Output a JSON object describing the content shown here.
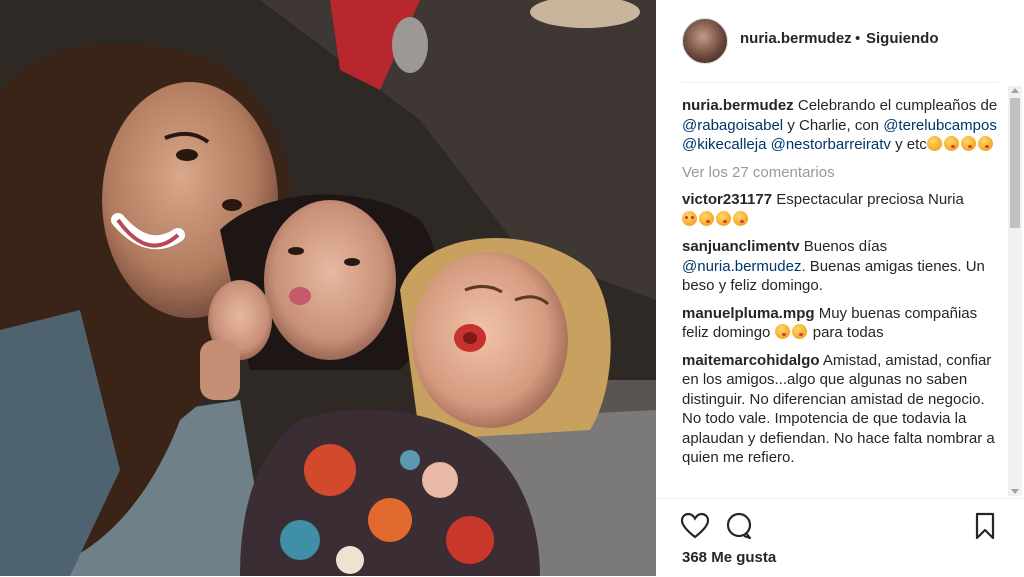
{
  "post": {
    "author": "nuria.bermudez",
    "separator": "•",
    "follow_state": "Siguiendo",
    "likes_text": "368 Me gusta"
  },
  "caption": {
    "user": "nuria.bermudez",
    "text_1": "Celebrando el cumpleaños de",
    "mention_1": "@rabagoisabel",
    "text_2": "y Charlie, con",
    "mention_2": "@terelubcampos",
    "mention_3": "@kikecalleja",
    "mention_4": "@nestorbarreiratv",
    "text_3": "y etc"
  },
  "view_all_comments": "Ver los 27 comentarios",
  "comments": [
    {
      "user": "victor231177",
      "text": "Espectacular preciosa Nuria"
    },
    {
      "user": "sanjuanclimentv",
      "text_1": "Buenos días",
      "mention": "@nuria.bermudez",
      "text_2": ". Buenas amigas tienes. Un beso y feliz domingo."
    },
    {
      "user": "manuelpluma.mpg",
      "text_1": "Muy buenas compañias feliz domingo",
      "text_2": "para todas"
    },
    {
      "user": "maitemarcohidalgo",
      "text": "Amistad, amistad, confiar en los amigos...algo que algunas no saben distinguir. No diferencian amistad de negocio. No todo vale. Impotencia de que todavia la aplaudan y defiendan. No hace falta nombrar a quien me refiero."
    }
  ],
  "icons": {
    "like": "heart-icon",
    "comment": "comment-icon",
    "save": "bookmark-icon"
  },
  "colors": {
    "mention": "#003569",
    "muted": "#999999",
    "text": "#262626"
  }
}
